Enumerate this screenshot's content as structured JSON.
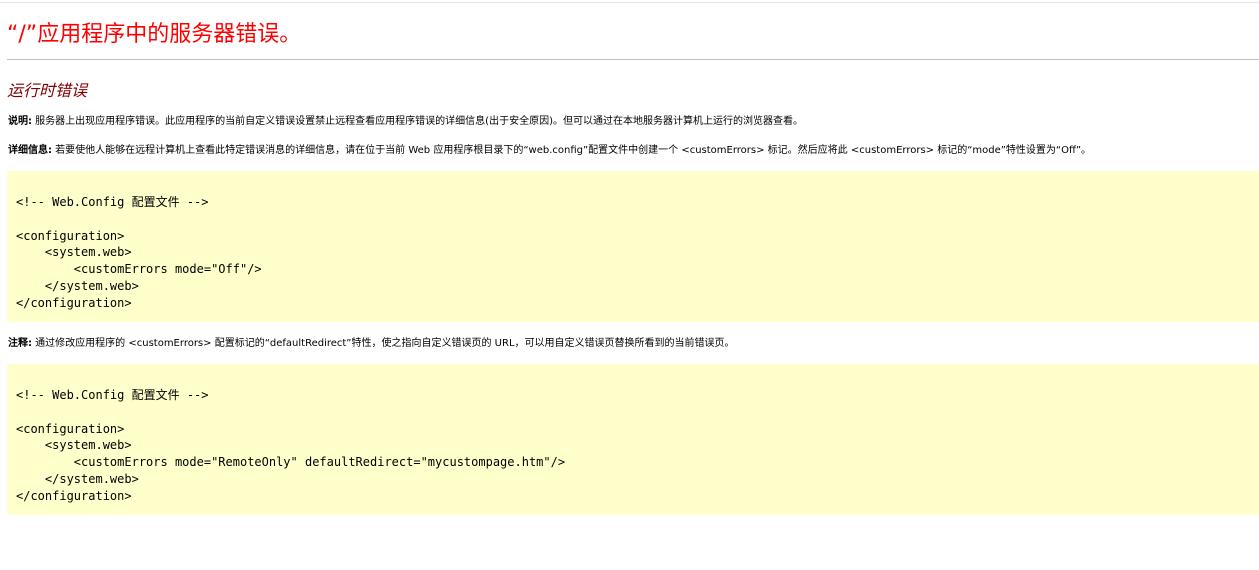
{
  "page": {
    "title": "“/”应用程序中的服务器错误。",
    "subtitle": "运行时错误",
    "description_label": "说明:",
    "description_text": " 服务器上出现应用程序错误。此应用程序的当前自定义错误设置禁止远程查看应用程序错误的详细信息(出于安全原因)。但可以通过在本地服务器计算机上运行的浏览器查看。",
    "details_label": "详细信息:",
    "details_text": " 若要使他人能够在远程计算机上查看此特定错误消息的详细信息，请在位于当前 Web 应用程序根目录下的“web.config”配置文件中创建一个 <customErrors> 标记。然后应将此 <customErrors> 标记的“mode”特性设置为“Off”。",
    "code_block_1": "<!-- Web.Config 配置文件 -->\n\n<configuration>\n    <system.web>\n        <customErrors mode=\"Off\"/>\n    </system.web>\n</configuration>",
    "note_label": "注释:",
    "note_text": " 通过修改应用程序的 <customErrors> 配置标记的“defaultRedirect”特性，使之指向自定义错误页的 URL，可以用自定义错误页替换所看到的当前错误页。",
    "code_block_2": "<!-- Web.Config 配置文件 -->\n\n<configuration>\n    <system.web>\n        <customErrors mode=\"RemoteOnly\" defaultRedirect=\"mycustompage.htm\"/>\n    </system.web>\n</configuration>"
  },
  "colors": {
    "title": "#ff0000",
    "subtitle": "#800000",
    "code_background": "#ffffcc"
  }
}
